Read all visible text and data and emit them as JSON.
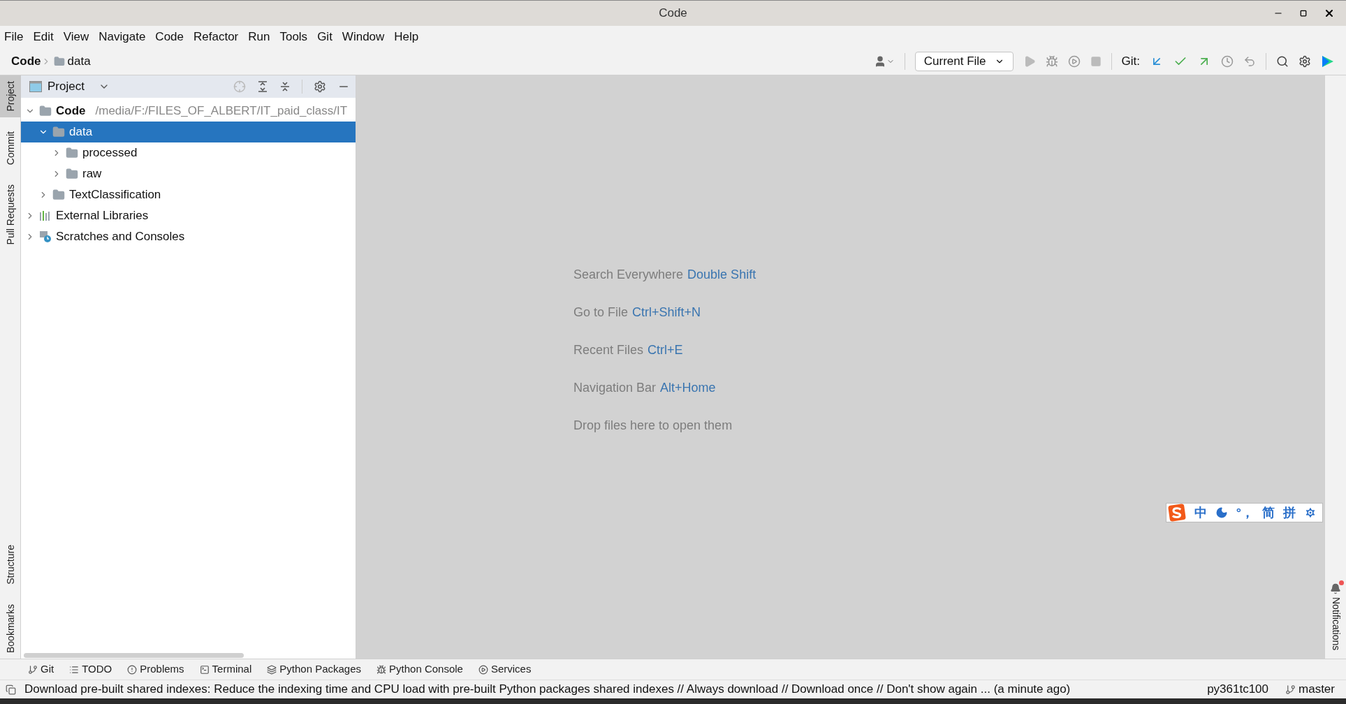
{
  "window": {
    "title": "Code"
  },
  "menu": [
    "File",
    "Edit",
    "View",
    "Navigate",
    "Code",
    "Refactor",
    "Run",
    "Tools",
    "Git",
    "Window",
    "Help"
  ],
  "breadcrumb": [
    {
      "label": "Code",
      "bold": true
    },
    {
      "label": "data",
      "bold": false
    }
  ],
  "toolbar": {
    "run_config": "Current File",
    "git_label": "Git:"
  },
  "left_strip": {
    "top": [
      {
        "label": "Project",
        "selected": true
      },
      {
        "label": "Commit",
        "selected": false
      },
      {
        "label": "Pull Requests",
        "selected": false
      }
    ],
    "bottom": [
      {
        "label": "Structure",
        "selected": false
      },
      {
        "label": "Bookmarks",
        "selected": false
      }
    ]
  },
  "project_panel": {
    "title": "Project",
    "tree": [
      {
        "label": "Code",
        "path": "/media/F:/FILES_OF_ALBERT/IT_paid_class/IT",
        "kind": "folder",
        "expanded": true,
        "selected": false,
        "children": [
          {
            "label": "data",
            "kind": "folder",
            "expanded": true,
            "selected": true,
            "children": [
              {
                "label": "processed",
                "kind": "folder",
                "expanded": false,
                "selected": false
              },
              {
                "label": "raw",
                "kind": "folder",
                "expanded": false,
                "selected": false
              }
            ]
          },
          {
            "label": "TextClassification",
            "kind": "folder",
            "expanded": false,
            "selected": false
          }
        ]
      },
      {
        "label": "External Libraries",
        "kind": "libraries",
        "expanded": false,
        "selected": false
      },
      {
        "label": "Scratches and Consoles",
        "kind": "scratches",
        "expanded": false,
        "selected": false
      }
    ]
  },
  "editor_hints": [
    {
      "text": "Search Everywhere",
      "shortcut": "Double Shift"
    },
    {
      "text": "Go to File",
      "shortcut": "Ctrl+Shift+N"
    },
    {
      "text": "Recent Files",
      "shortcut": "Ctrl+E"
    },
    {
      "text": "Navigation Bar",
      "shortcut": "Alt+Home"
    },
    {
      "text": "Drop files here to open them"
    }
  ],
  "ime_toolbar": {
    "items": [
      "中",
      "°，",
      "简",
      "拼"
    ]
  },
  "right_strip": {
    "label": "Notifications"
  },
  "tool_windows": [
    "Git",
    "TODO",
    "Problems",
    "Terminal",
    "Python Packages",
    "Python Console",
    "Services"
  ],
  "status_bar": {
    "message": "Download pre-built shared indexes: Reduce the indexing time and CPU load with pre-built Python packages shared indexes // Always download // Download once // Don't show again ... (a minute ago)",
    "interpreter": "py361tc100",
    "branch": "master"
  }
}
